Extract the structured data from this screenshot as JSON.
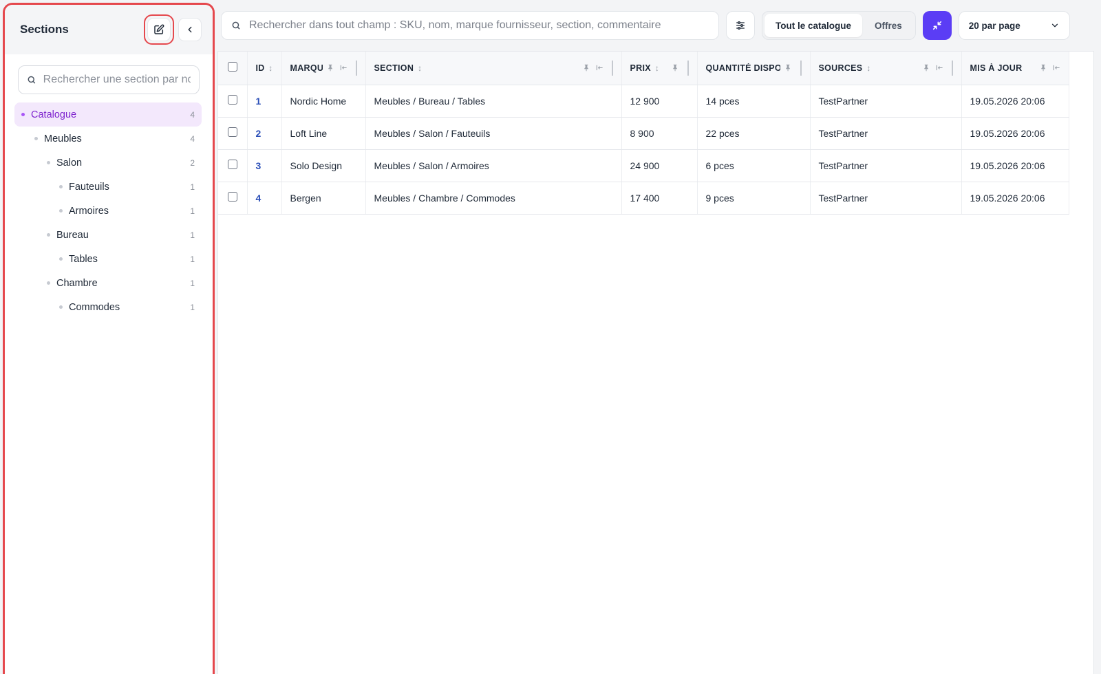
{
  "sidebar": {
    "title": "Sections",
    "search_placeholder": "Rechercher une section par nom",
    "tree": [
      {
        "label": "Catalogue",
        "count": "4",
        "level": 0,
        "active": true
      },
      {
        "label": "Meubles",
        "count": "4",
        "level": 1
      },
      {
        "label": "Salon",
        "count": "2",
        "level": 2
      },
      {
        "label": "Fauteuils",
        "count": "1",
        "level": 3
      },
      {
        "label": "Armoires",
        "count": "1",
        "level": 3
      },
      {
        "label": "Bureau",
        "count": "1",
        "level": 2
      },
      {
        "label": "Tables",
        "count": "1",
        "level": 3
      },
      {
        "label": "Chambre",
        "count": "1",
        "level": 2
      },
      {
        "label": "Commodes",
        "count": "1",
        "level": 3
      }
    ]
  },
  "toolbar": {
    "search_placeholder": "Rechercher dans tout champ : SKU, nom, marque fournisseur, section, commentaire",
    "seg_all": "Tout le catalogue",
    "seg_offers": "Offres",
    "per_page": "20 par page"
  },
  "table": {
    "headers": {
      "id": "ID",
      "brand": "MARQU",
      "section": "SECTION",
      "price": "PRIX",
      "qty": "QUANTITÉ DISPON",
      "sources": "SOURCES",
      "updated": "MIS À JOUR"
    },
    "rows": [
      {
        "id": "1",
        "brand": "Nordic Home",
        "section": "Meubles / Bureau / Tables",
        "price": "12 900",
        "qty": "14 pces",
        "sources": "TestPartner",
        "updated": "19.05.2026 20:06"
      },
      {
        "id": "2",
        "brand": "Loft Line",
        "section": "Meubles / Salon / Fauteuils",
        "price": "8 900",
        "qty": "22 pces",
        "sources": "TestPartner",
        "updated": "19.05.2026 20:06"
      },
      {
        "id": "3",
        "brand": "Solo Design",
        "section": "Meubles / Salon / Armoires",
        "price": "24 900",
        "qty": "6 pces",
        "sources": "TestPartner",
        "updated": "19.05.2026 20:06"
      },
      {
        "id": "4",
        "brand": "Bergen",
        "section": "Meubles / Chambre / Commodes",
        "price": "17 400",
        "qty": "9 pces",
        "sources": "TestPartner",
        "updated": "19.05.2026 20:06"
      }
    ]
  },
  "colors": {
    "accent": "#5b3df5",
    "active_section": "#7e22ce",
    "highlight": "#e5484d",
    "id_link": "#2b4fb8"
  }
}
